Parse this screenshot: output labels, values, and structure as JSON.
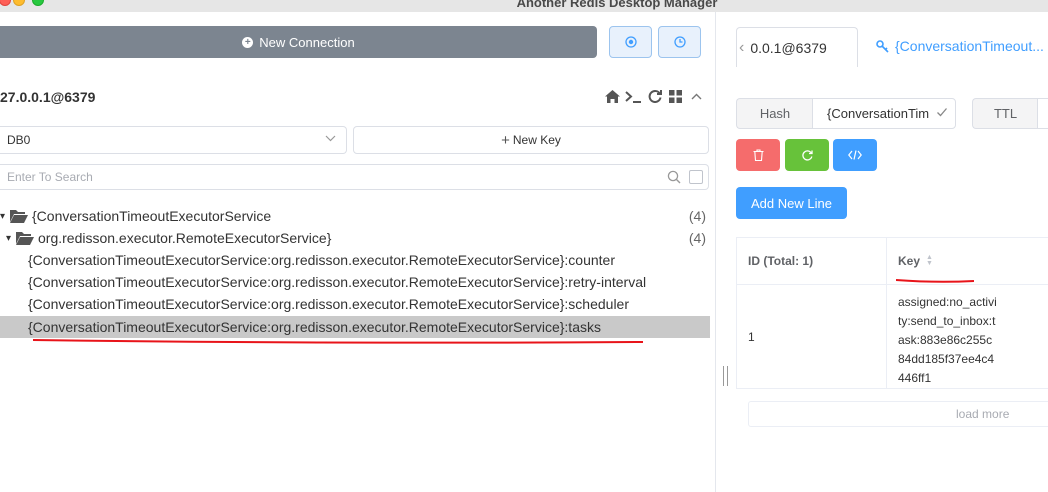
{
  "window": {
    "title": "Another Redis Desktop Manager"
  },
  "left": {
    "new_connection_label": "New Connection",
    "connection_name": "27.0.0.1@6379",
    "db_select_value": "DB0",
    "new_key_label": "New Key",
    "search_placeholder": "Enter To Search",
    "tree": [
      {
        "label": "{ConversationTimeoutExecutorService",
        "count": "(4)",
        "type": "folder",
        "level": 0
      },
      {
        "label": "org.redisson.executor.RemoteExecutorService}",
        "count": "(4)",
        "type": "folder",
        "level": 1
      },
      {
        "label": "{ConversationTimeoutExecutorService:org.redisson.executor.RemoteExecutorService}:counter",
        "type": "key",
        "level": 2
      },
      {
        "label": "{ConversationTimeoutExecutorService:org.redisson.executor.RemoteExecutorService}:retry-interval",
        "type": "key",
        "level": 2
      },
      {
        "label": "{ConversationTimeoutExecutorService:org.redisson.executor.RemoteExecutorService}:scheduler",
        "type": "key",
        "level": 2
      },
      {
        "label": "{ConversationTimeoutExecutorService:org.redisson.executor.RemoteExecutorService}:tasks",
        "type": "key",
        "level": 2,
        "selected": true
      }
    ]
  },
  "right": {
    "tab_connection": "0.0.1@6379",
    "tab_key": "{ConversationTimeout...",
    "type_label": "Hash",
    "key_value": "{ConversationTim",
    "ttl_label": "TTL",
    "add_line_label": "Add New Line",
    "table": {
      "col_id": "ID (Total: 1)",
      "col_key": "Key",
      "rows": [
        {
          "id": "1",
          "key": "assigned:no_activity:send_to_inbox:task:883e86c255c84dd185f37ee4c4446ff1"
        }
      ]
    },
    "load_more_label": "load more"
  },
  "colors": {
    "accent": "#409eff",
    "danger": "#f56c6c",
    "success": "#67c23a",
    "annotation": "#e8141a",
    "selected_row": "#c9c9c9"
  }
}
